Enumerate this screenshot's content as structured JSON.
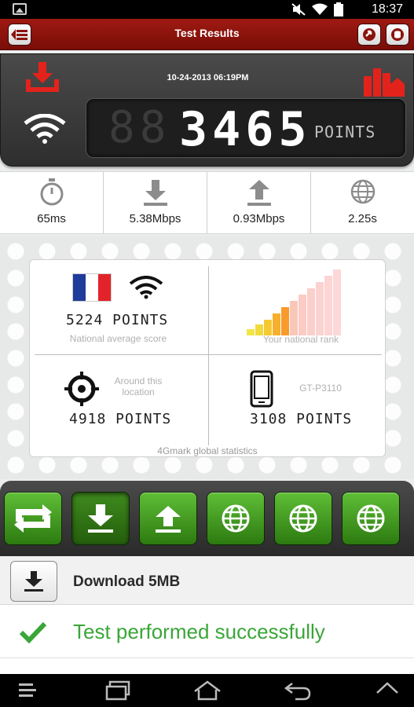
{
  "status_bar": {
    "time": "18:37"
  },
  "header": {
    "title": "Test Results"
  },
  "score": {
    "date": "10-24-2013 06:19PM",
    "value": "3465",
    "ghost": "88",
    "unit": "POINTS"
  },
  "metrics": [
    {
      "icon": "stopwatch-icon",
      "value": "65ms"
    },
    {
      "icon": "download-arrow-icon",
      "value": "5.38Mbps"
    },
    {
      "icon": "upload-arrow-icon",
      "value": "0.93Mbps"
    },
    {
      "icon": "globe-icon",
      "value": "2.25s"
    }
  ],
  "stats": {
    "national": {
      "score": "5224 POINTS",
      "label": "National average score"
    },
    "rank": {
      "label": "Your national rank"
    },
    "location": {
      "label": "Around this location",
      "score": "4918 POINTS"
    },
    "device": {
      "model": "GT-P3110",
      "score": "3108 POINTS"
    },
    "footer": "4Gmark global statistics"
  },
  "tabs": [
    {
      "icon": "repeat-icon"
    },
    {
      "icon": "download-icon",
      "active": true
    },
    {
      "icon": "upload-icon"
    },
    {
      "icon": "globe-icon"
    },
    {
      "icon": "globe-icon"
    },
    {
      "icon": "globe-icon"
    }
  ],
  "list": {
    "row1": {
      "label": "Download 5MB"
    },
    "row2": {
      "label": "Test performed successfully"
    }
  },
  "colors": {
    "header_red": "#8b140d",
    "accent_green": "#3aa638",
    "lcd_bg": "#1e1e1e"
  }
}
